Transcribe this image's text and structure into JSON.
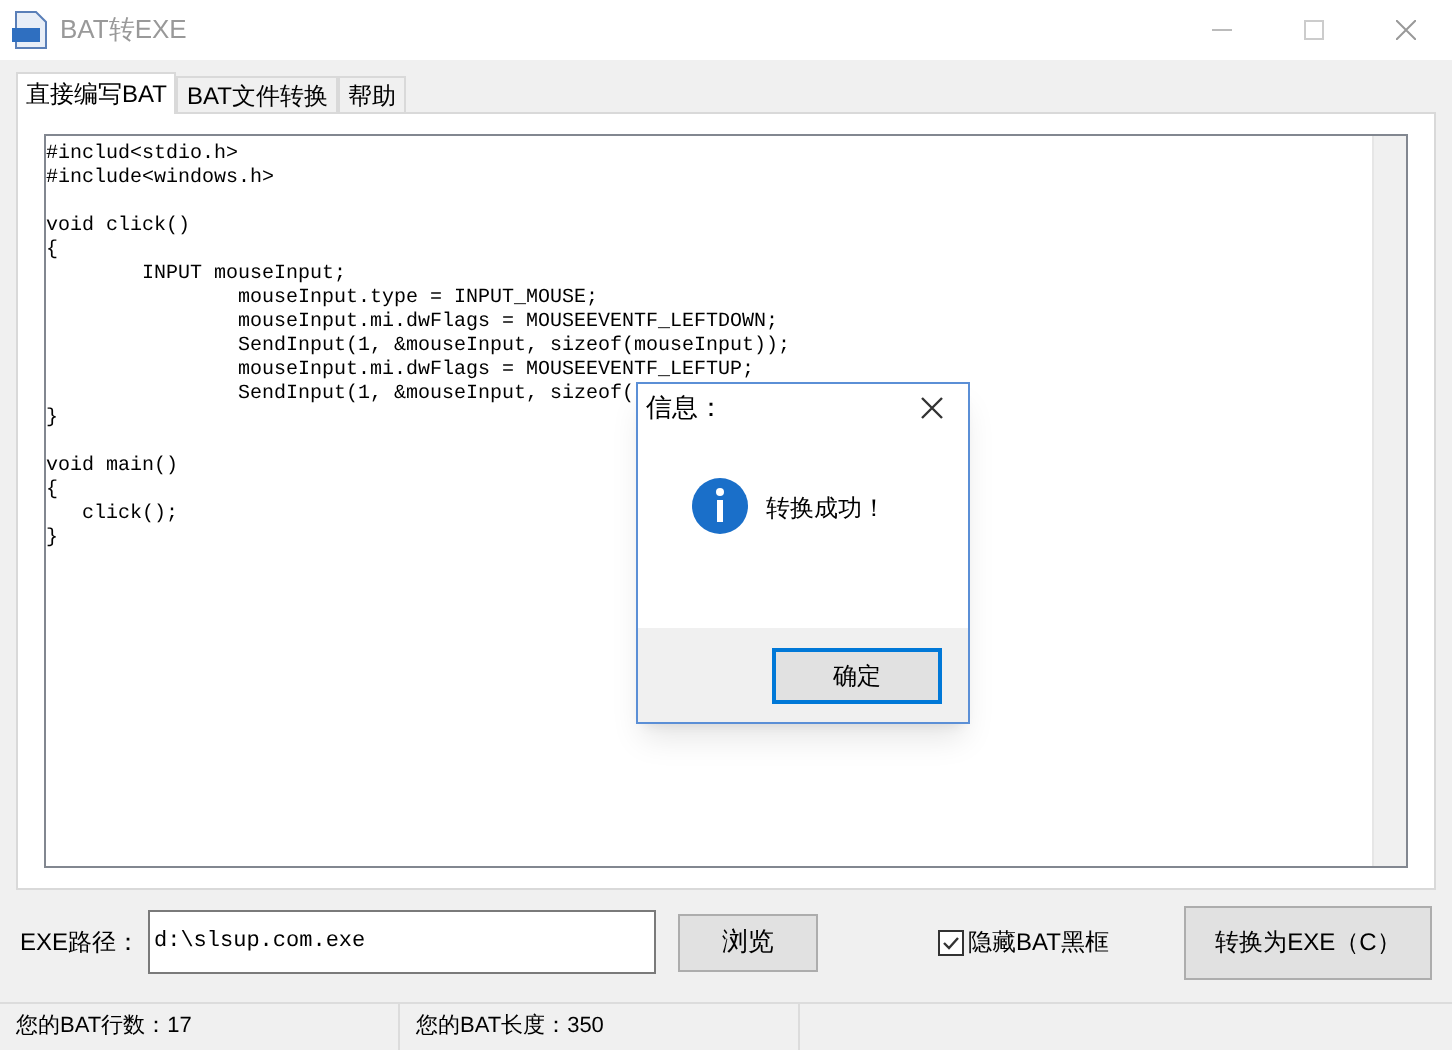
{
  "window": {
    "title": "BAT转EXE"
  },
  "tabs": [
    {
      "label": "直接编写BAT",
      "selected": true
    },
    {
      "label": "BAT文件转换",
      "selected": false
    },
    {
      "label": "帮助",
      "selected": false
    }
  ],
  "editor": {
    "blocks": [
      [
        "#includ<stdio.h>",
        "#include<windows.h>"
      ],
      [
        "void click()",
        "{",
        "        INPUT mouseInput;",
        "                mouseInput.type = INPUT_MOUSE;",
        "                mouseInput.mi.dwFlags = MOUSEEVENTF_LEFTDOWN;",
        "                SendInput(1, &mouseInput, sizeof(mouseInput));",
        "                mouseInput.mi.dwFlags = MOUSEEVENTF_LEFTUP;",
        "                SendInput(1, &mouseInput, sizeof(",
        "}"
      ],
      [
        "void main()",
        "{",
        "   click();",
        "}"
      ]
    ]
  },
  "exe_path": {
    "label": "EXE路径：",
    "value": "d:\\slsup.com.exe"
  },
  "browse_button": "浏览",
  "hide_console": {
    "label": "隐藏BAT黑框",
    "checked": true
  },
  "convert_button": "转换为EXE（C）",
  "status_bar": [
    "您的BAT行数：17",
    "您的BAT长度：350"
  ],
  "dialog": {
    "title": "信息：",
    "message": "转换成功！",
    "button": "确定"
  }
}
